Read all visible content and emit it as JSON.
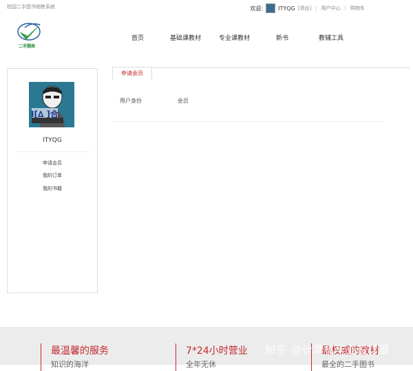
{
  "header": {
    "site_name": "校园二手图书销售系统",
    "welcome": "欢迎:",
    "username": "ITYQG",
    "logout": "[退出]",
    "user_center": "用户中心",
    "cart": "购物车",
    "logo_text": "二手圈商"
  },
  "nav": {
    "items": [
      "首页",
      "基础课教材",
      "专业课教材",
      "新书",
      "教辅工具"
    ]
  },
  "sidebar": {
    "username": "ITYQG",
    "avatar_text": "Ⅰ[∆ ]合",
    "links": [
      "申请会员",
      "我的订单",
      "我的书籍"
    ]
  },
  "content": {
    "tab_label": "申请会员",
    "row_label": "用户身份",
    "row_value": "会员"
  },
  "footer": {
    "features": [
      {
        "title": "最温馨的服务",
        "sub": "知识的海洋"
      },
      {
        "title": "7*24小时营业",
        "sub": "全年无休"
      },
      {
        "title": "最权威的教材",
        "sub": "最全的二手图书"
      }
    ],
    "watermark": "知乎 @计算机毕业设计展"
  },
  "colors": {
    "accent": "#c3282c",
    "footer_bg": "#ececec",
    "logo_green": "#2b8a3e"
  }
}
